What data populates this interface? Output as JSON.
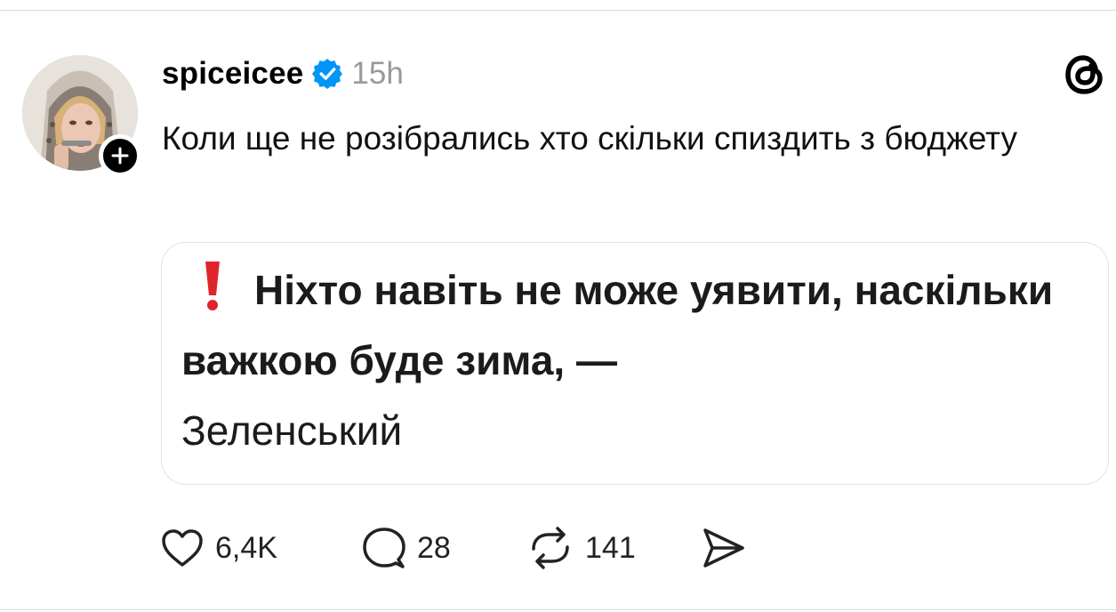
{
  "post": {
    "username": "spiceicee",
    "verified": true,
    "time": "15h",
    "text": "Коли ще не розібрались хто скільки спиздить з бюджету"
  },
  "quote_image": {
    "line_bold": "Ніхто навіть не може уявити, наскільки важкою буде зима, —",
    "line_regular": "Зеленський",
    "exclamation_color": "#e0242c"
  },
  "actions": {
    "likes": "6,4K",
    "replies": "28",
    "reposts": "141"
  },
  "icons": {
    "verified": "verified-badge-icon",
    "follow": "plus-icon",
    "logo": "threads-logo-icon",
    "like": "heart-icon",
    "reply": "comment-bubble-icon",
    "repost": "repost-arrows-icon",
    "share": "send-arrow-icon"
  },
  "colors": {
    "verified_blue": "#0095f6",
    "muted_text": "#999999"
  }
}
